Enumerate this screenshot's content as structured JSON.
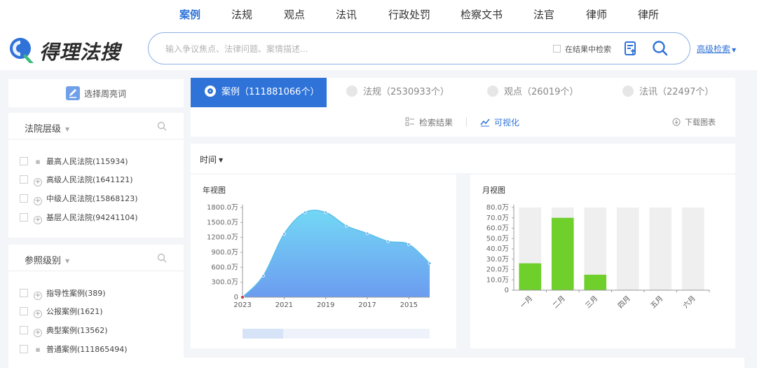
{
  "topnav": {
    "items": [
      {
        "label": "案例",
        "active": true
      },
      {
        "label": "法规"
      },
      {
        "label": "观点"
      },
      {
        "label": "法讯"
      },
      {
        "label": "行政处罚"
      },
      {
        "label": "检察文书"
      },
      {
        "label": "法官"
      },
      {
        "label": "律师"
      },
      {
        "label": "律所"
      }
    ]
  },
  "header": {
    "logo_text": "得理法搜",
    "search_placeholder": "输入争议焦点、法律问题、案情描述...",
    "search_value": "",
    "in_results_label": "在结果中检索",
    "advanced_label": "高级检索"
  },
  "sidebar": {
    "select_study_label": "选择周亮词",
    "court_level": {
      "title": "法院层级",
      "items": [
        {
          "label": "最高人民法院(115934)",
          "marker": "dot"
        },
        {
          "label": "高级人民法院(1641121)",
          "marker": "plus"
        },
        {
          "label": "中级人民法院(15868123)",
          "marker": "plus"
        },
        {
          "label": "基层人民法院(94241104)",
          "marker": "plus"
        }
      ]
    },
    "reference_level": {
      "title": "参照级别",
      "items": [
        {
          "label": "指导性案例(389)",
          "marker": "plus"
        },
        {
          "label": "公报案例(1621)",
          "marker": "plus"
        },
        {
          "label": "典型案例(13562)",
          "marker": "plus"
        },
        {
          "label": "普通案例(111865494)",
          "marker": "dot"
        }
      ]
    }
  },
  "result_tabs": [
    {
      "label": "案例（111881066个）",
      "active": true
    },
    {
      "label": "法规（2530933个）"
    },
    {
      "label": "观点（26019个）"
    },
    {
      "label": "法讯（22497个）"
    }
  ],
  "viewbar": {
    "results_label": "检索结果",
    "visual_label": "可视化",
    "download_label": "下载图表"
  },
  "time_filter_label": "时间",
  "chart_data": [
    {
      "type": "area",
      "title": "年视图",
      "x_ticks": [
        "2023",
        "2021",
        "2019",
        "2017",
        "2015"
      ],
      "x": [
        2023,
        2022,
        2021,
        2020,
        2019,
        2018,
        2017,
        2016,
        2015,
        2014
      ],
      "values": [
        0,
        430,
        1270,
        1700,
        1700,
        1430,
        1280,
        1120,
        1060,
        680
      ],
      "unit": "万",
      "y_ticks": [
        "0",
        "300.0万",
        "600.0万",
        "900.0万",
        "1200.0万",
        "1500.0万",
        "1800.0万"
      ],
      "ylim": [
        0,
        1800
      ],
      "x_axis_reversed": true,
      "colors": {
        "top": "#73d8f5",
        "bottom": "#6c9cf0",
        "line": "#5bbfe8"
      }
    },
    {
      "type": "bar",
      "title": "月视图",
      "categories": [
        "一月",
        "二月",
        "三月",
        "四月",
        "五月",
        "六月"
      ],
      "values": [
        26,
        70,
        15,
        0,
        0,
        0
      ],
      "unit": "万",
      "y_ticks": [
        "0",
        "10.0万",
        "20.0万",
        "30.0万",
        "40.0万",
        "50.0万",
        "60.0万",
        "70.0万",
        "80.0万"
      ],
      "ylim": [
        0,
        80
      ],
      "colors": {
        "bar": "#6fcf2b",
        "background": "#efefef"
      }
    }
  ],
  "colors": {
    "accent": "#2f73d9"
  }
}
